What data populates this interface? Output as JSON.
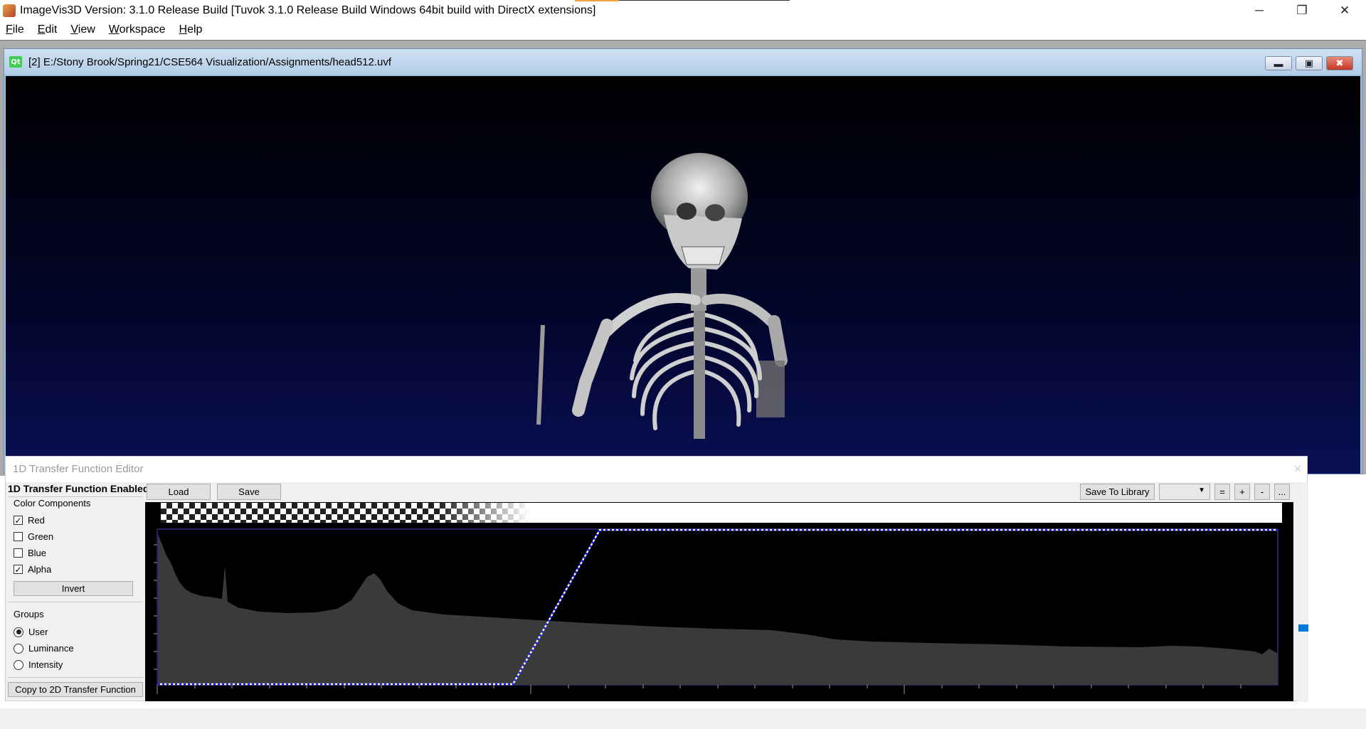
{
  "window": {
    "title": "ImageVis3D Version: 3.1.0 Release Build [Tuvok 3.1.0 Release Build Windows 64bit build with DirectX extensions]",
    "minimize_glyph": "─",
    "restore_glyph": "❐",
    "close_glyph": "✕"
  },
  "menu": [
    {
      "key": "F",
      "rest": "ile"
    },
    {
      "key": "E",
      "rest": "dit"
    },
    {
      "key": "V",
      "rest": "iew"
    },
    {
      "key": "W",
      "rest": "orkspace"
    },
    {
      "key": "H",
      "rest": "elp"
    }
  ],
  "render_window": {
    "qt_label": "Qt",
    "title": "[2] E:/Stony Brook/Spring21/CSE564 Visualization/Assignments/head512.uvf",
    "minimize_glyph": "▬",
    "restore_glyph": "▣",
    "close_glyph": "✖"
  },
  "tf_editor": {
    "title": "1D Transfer Function Editor",
    "close_glyph": "✕",
    "enabled_label": "1D Transfer Function Enabled",
    "color_components": {
      "title": "Color Components",
      "items": [
        {
          "label": "Red",
          "checked": true
        },
        {
          "label": "Green",
          "checked": false
        },
        {
          "label": "Blue",
          "checked": false
        },
        {
          "label": "Alpha",
          "checked": true
        }
      ]
    },
    "invert_label": "Invert",
    "groups": {
      "title": "Groups",
      "items": [
        {
          "label": "User",
          "selected": true
        },
        {
          "label": "Luminance",
          "selected": false
        },
        {
          "label": "Intensity",
          "selected": false
        }
      ]
    },
    "copy_2d_label": "Copy to 2D Transfer Function",
    "load_label": "Load",
    "save_label": "Save",
    "save_library_label": "Save To Library",
    "library_select_value": "",
    "btn_equal": "=",
    "btn_plus": "+",
    "btn_minus": "-",
    "btn_more": "...",
    "colors": {
      "histogram": "#3a3a3a",
      "curve": "#ffffff",
      "curve_dash": "#1a1aff",
      "frame": "#4040c0"
    }
  }
}
